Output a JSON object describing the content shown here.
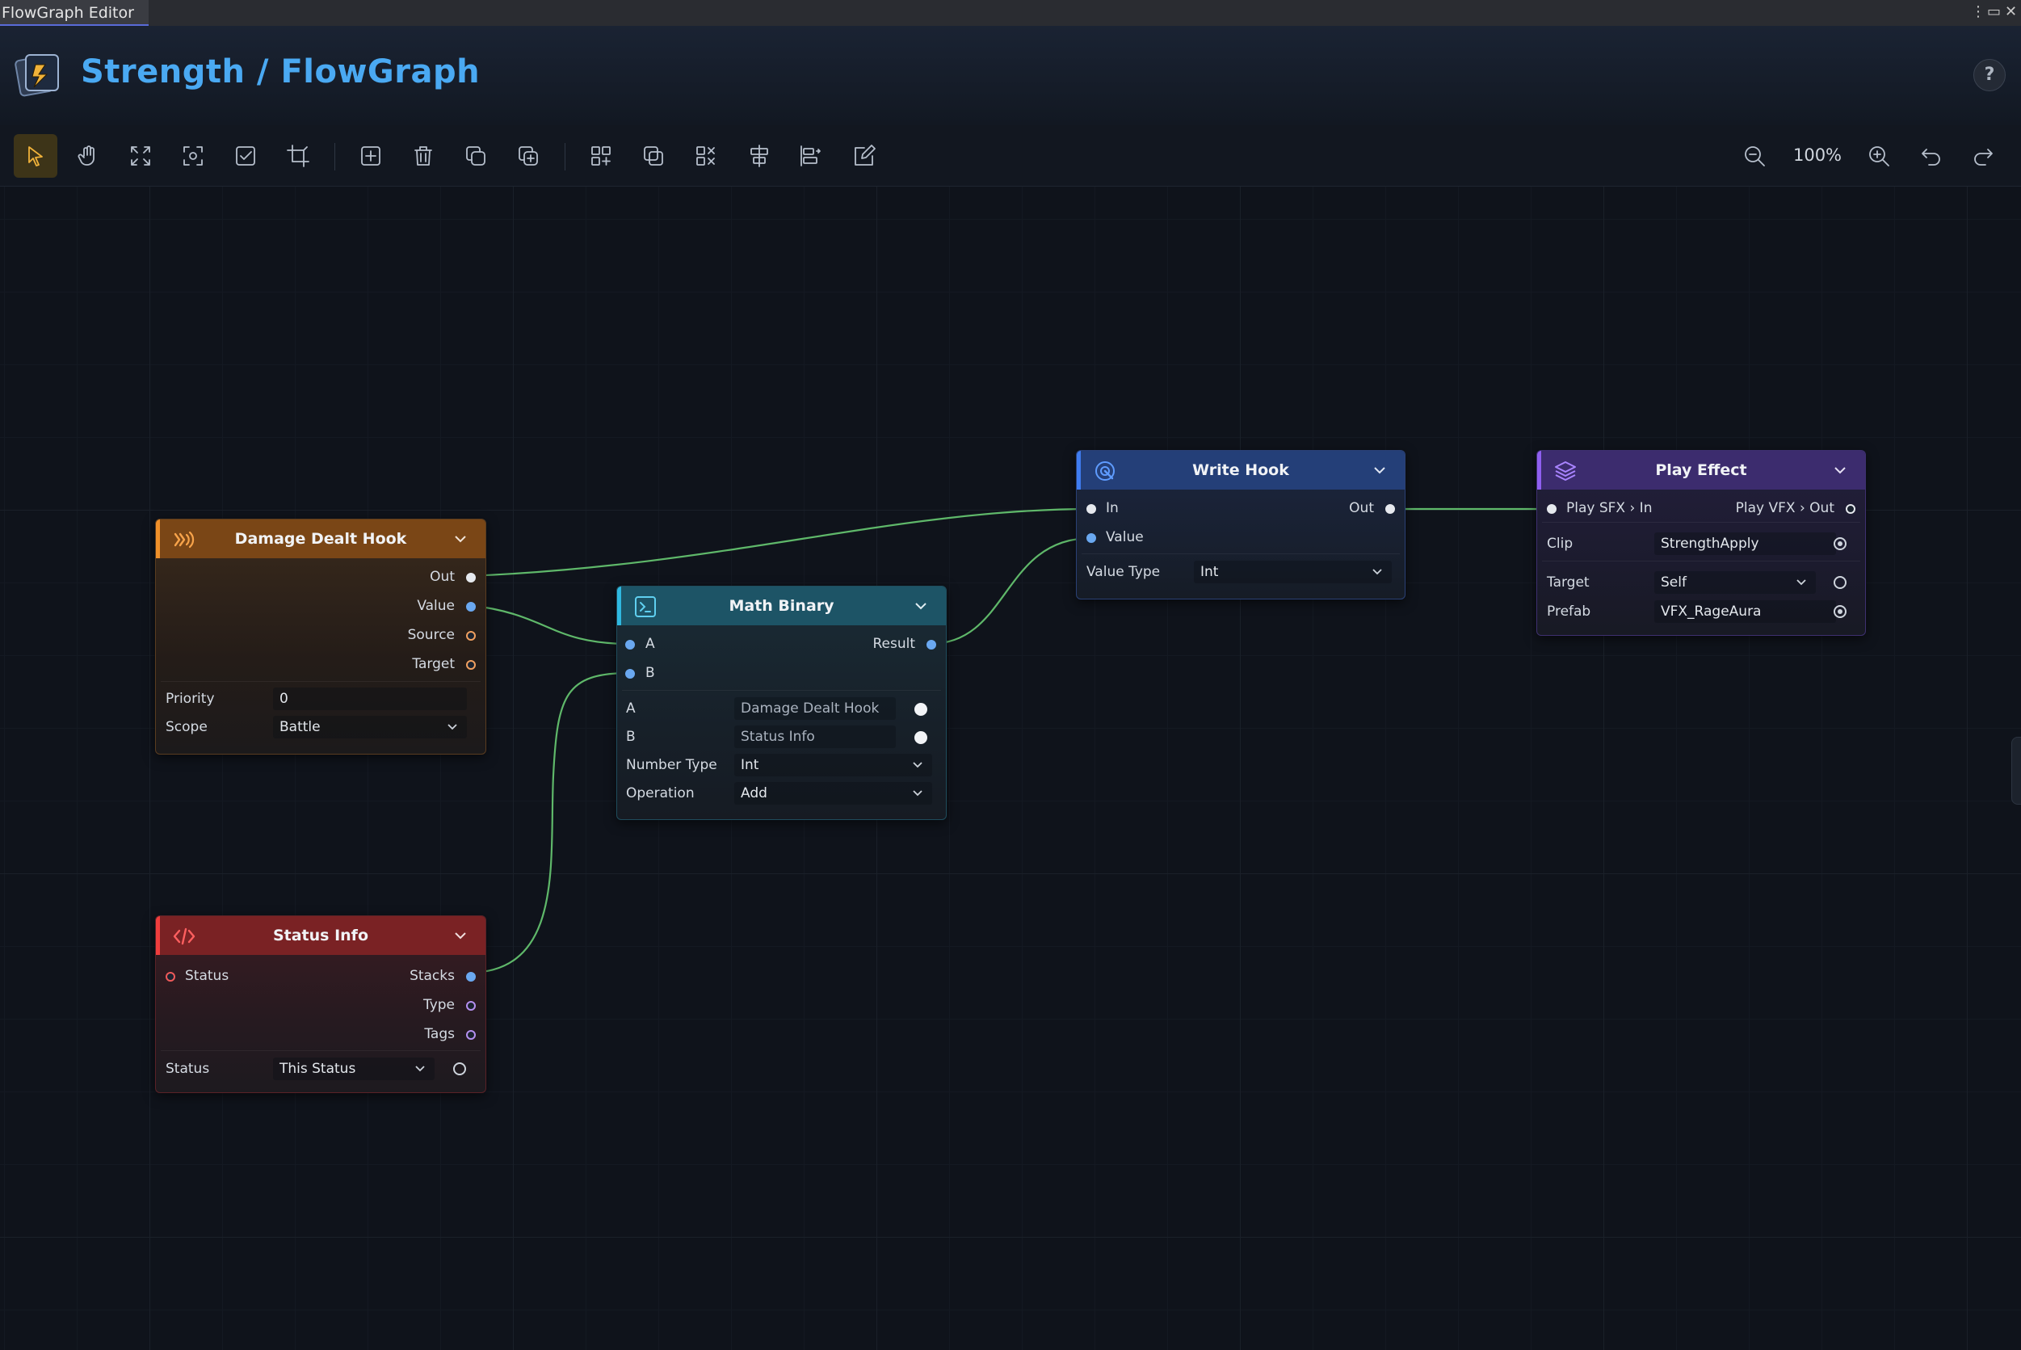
{
  "window": {
    "tab_title": "FlowGraph Editor",
    "controls": [
      "⋮",
      "▭",
      "✕"
    ]
  },
  "header": {
    "title": "Strength / FlowGraph",
    "help_label": "?"
  },
  "toolbar": {
    "tools": [
      {
        "name": "select-tool",
        "icon": "cursor-icon",
        "active": true
      },
      {
        "name": "pan-tool",
        "icon": "hand-icon"
      },
      {
        "name": "fit-view",
        "icon": "expand-icon"
      },
      {
        "name": "focus-selection",
        "icon": "focus-icon"
      },
      {
        "name": "select-all",
        "icon": "checkbox-icon"
      },
      {
        "name": "crop-tool",
        "icon": "crop-icon"
      },
      {
        "name": "add-node",
        "icon": "plus-square-icon"
      },
      {
        "name": "delete-node",
        "icon": "trash-icon"
      },
      {
        "name": "duplicate-node",
        "icon": "copy-icon"
      },
      {
        "name": "copy-node",
        "icon": "copy-link-icon"
      },
      {
        "name": "group-nodes",
        "icon": "grid-plus-icon"
      },
      {
        "name": "select-group",
        "icon": "square-stack-icon"
      },
      {
        "name": "ungroup-nodes",
        "icon": "grid-x-icon"
      },
      {
        "name": "align-center",
        "icon": "align-center-icon"
      },
      {
        "name": "distribute-nodes",
        "icon": "distribute-icon"
      },
      {
        "name": "edit-graph",
        "icon": "edit-icon"
      }
    ],
    "zoom_level": "100%"
  },
  "nodes": {
    "damage_dealt_hook": {
      "title": "Damage Dealt Hook",
      "outputs": [
        "Out",
        "Value",
        "Source",
        "Target"
      ],
      "priority_label": "Priority",
      "priority_value": "0",
      "scope_label": "Scope",
      "scope_value": "Battle",
      "color": "#7a4616"
    },
    "status_info": {
      "title": "Status Info",
      "input": "Status",
      "outputs": [
        "Stacks",
        "Type",
        "Tags"
      ],
      "status_label": "Status",
      "status_value": "This Status",
      "color": "#7a2224"
    },
    "math_binary": {
      "title": "Math Binary",
      "inputs": [
        "A",
        "B"
      ],
      "output": "Result",
      "a_label": "A",
      "a_value": "Damage Dealt Hook",
      "b_label": "B",
      "b_value": "Status Info",
      "number_type_label": "Number Type",
      "number_type_value": "Int",
      "operation_label": "Operation",
      "operation_value": "Add",
      "color": "#1d5466"
    },
    "write_hook": {
      "title": "Write Hook",
      "inputs": [
        "In",
        "Value"
      ],
      "output": "Out",
      "value_type_label": "Value Type",
      "value_type_value": "Int",
      "color": "#243f78"
    },
    "play_effect": {
      "title": "Play Effect",
      "input": "Play SFX › In",
      "output": "Play VFX › Out",
      "clip_label": "Clip",
      "clip_value": "StrengthApply",
      "target_label": "Target",
      "target_value": "Self",
      "prefab_label": "Prefab",
      "prefab_value": "VFX_RageAura",
      "color": "#3c2c6e"
    }
  },
  "wire_color": "#5fb86a"
}
